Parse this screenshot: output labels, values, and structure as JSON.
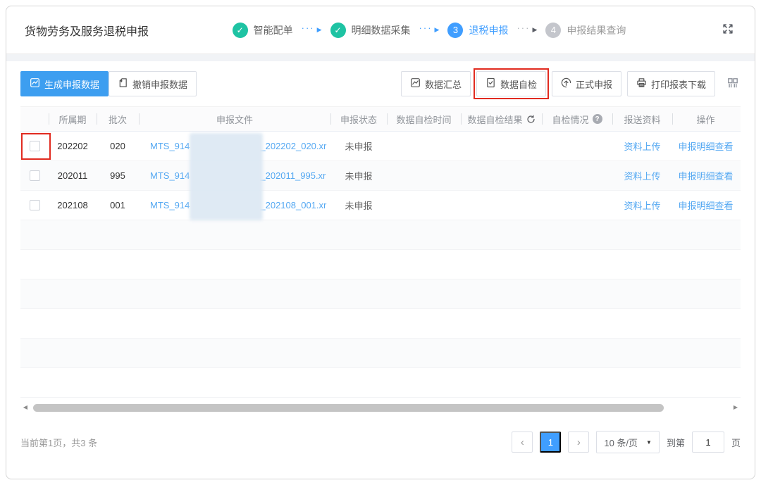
{
  "header": {
    "title": "货物劳务及服务退税申报"
  },
  "steps": [
    {
      "label": "智能配单",
      "state": "done"
    },
    {
      "label": "明细数据采集",
      "state": "done"
    },
    {
      "number": "3",
      "label": "退税申报",
      "state": "current"
    },
    {
      "number": "4",
      "label": "申报结果查询",
      "state": "pending"
    }
  ],
  "toolbar": {
    "generate_label": "生成申报数据",
    "revoke_label": "撤销申报数据",
    "summary_label": "数据汇总",
    "selfcheck_label": "数据自检",
    "formal_label": "正式申报",
    "print_label": "打印报表下载"
  },
  "table": {
    "columns": {
      "period": "所属期",
      "batch": "批次",
      "file": "申报文件",
      "status": "申报状态",
      "check_time": "数据自检时间",
      "check_result": "数据自检结果",
      "check_state": "自检情况",
      "materials": "报送资料",
      "action": "操作"
    },
    "rows": [
      {
        "period": "202202",
        "batch": "020",
        "file_prefix": "MTS_914",
        "file_suffix": "_202202_020.xr",
        "status": "未申报",
        "check_time": "",
        "check_result": "",
        "check_state": "",
        "upload_label": "资料上传",
        "detail_label": "申报明细查看"
      },
      {
        "period": "202011",
        "batch": "995",
        "file_prefix": "MTS_914",
        "file_suffix": "_202011_995.xr",
        "status": "未申报",
        "check_time": "",
        "check_result": "",
        "check_state": "",
        "upload_label": "资料上传",
        "detail_label": "申报明细查看"
      },
      {
        "period": "202108",
        "batch": "001",
        "file_prefix": "MTS_914",
        "file_suffix": "_202108_001.xr",
        "status": "未申报",
        "check_time": "",
        "check_result": "",
        "check_state": "",
        "upload_label": "资料上传",
        "detail_label": "申报明细查看"
      }
    ]
  },
  "pagination": {
    "summary": "当前第1页，共3 条",
    "current_page": "1",
    "page_size": "10 条/页",
    "goto_prefix": "到第",
    "goto_value": "1",
    "goto_suffix": "页"
  },
  "icons": {
    "check": "✓",
    "help": "?",
    "connector_dots": "···",
    "connector_arrow": "▶",
    "prev": "‹",
    "next": "›",
    "dropdown_caret": "▼",
    "scroll_left": "◀",
    "scroll_right": "▶"
  },
  "colors": {
    "accent": "#409EFF",
    "success": "#1EC3A3",
    "pending_gray": "#C4C6CC",
    "link": "#54A8F2",
    "annotation_red": "#E12B20"
  }
}
